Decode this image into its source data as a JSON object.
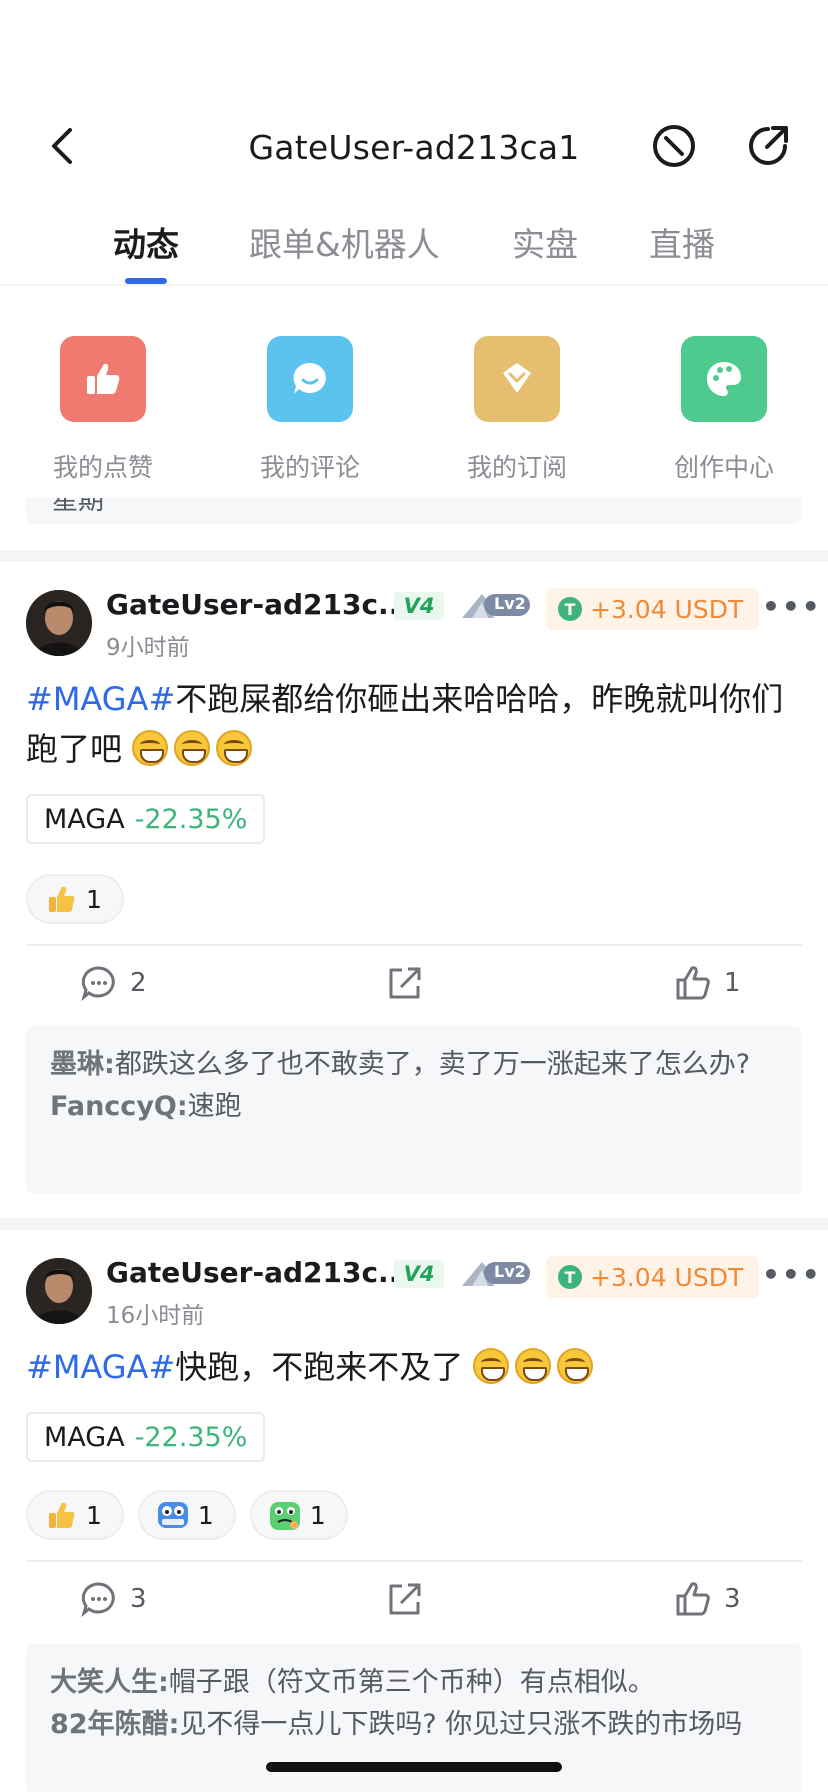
{
  "header": {
    "title": "GateUser-ad213ca1",
    "back_icon": "chevron-left-icon",
    "block_icon": "block-icon",
    "share_icon": "share-icon"
  },
  "tabs": [
    {
      "label": "动态",
      "active": true
    },
    {
      "label": "跟单&机器人",
      "active": false
    },
    {
      "label": "实盘",
      "active": false
    },
    {
      "label": "直播",
      "active": false
    }
  ],
  "shortcuts": [
    {
      "label": "我的点赞",
      "color": "#f07a6f",
      "icon": "thumbs-up-icon"
    },
    {
      "label": "我的评论",
      "color": "#5cc3ee",
      "icon": "chat-bubble-icon"
    },
    {
      "label": "我的订阅",
      "color": "#e5bf6f",
      "icon": "diamond-icon"
    },
    {
      "label": "创作中心",
      "color": "#4fca8f",
      "icon": "palette-icon"
    }
  ],
  "peek_text": "星期",
  "posts": [
    {
      "author": "GateUser-ad213c...",
      "vip": "V4",
      "level": "Lv2",
      "reward": "+3.04 USDT",
      "time": "9小时前",
      "hashtag": "#MAGA#",
      "text": "不跑屎都给你砸出来哈哈哈，昨晚就叫你们跑了吧",
      "coin": {
        "symbol": "MAGA",
        "change": "-22.35%"
      },
      "reactions": [
        {
          "icon": "thumbs-up-emoji-icon",
          "count": "1"
        }
      ],
      "actions": {
        "comments": "2",
        "likes": "1"
      },
      "comments": [
        {
          "user": "墨琳:",
          "text": "都跌这么多了也不敢卖了，卖了万一涨起来了怎么办?"
        },
        {
          "user": "FanccyQ:",
          "text": "速跑"
        }
      ]
    },
    {
      "author": "GateUser-ad213c...",
      "vip": "V4",
      "level": "Lv2",
      "reward": "+3.04 USDT",
      "time": "16小时前",
      "hashtag": "#MAGA#",
      "text": "快跑，不跑来不及了",
      "coin": {
        "symbol": "MAGA",
        "change": "-22.35%"
      },
      "reactions": [
        {
          "icon": "thumbs-up-emoji-icon",
          "count": "1"
        },
        {
          "icon": "hodl-robot-icon",
          "count": "1"
        },
        {
          "icon": "thinking-frog-icon",
          "count": "1"
        }
      ],
      "actions": {
        "comments": "3",
        "likes": "3"
      },
      "comments": [
        {
          "user": "大笑人生:",
          "text": "帽子跟（符文币第三个币种）有点相似。"
        },
        {
          "user": "82年陈醋:",
          "text": "见不得一点儿下跌吗? 你见过只涨不跌的市场吗"
        }
      ]
    }
  ]
}
